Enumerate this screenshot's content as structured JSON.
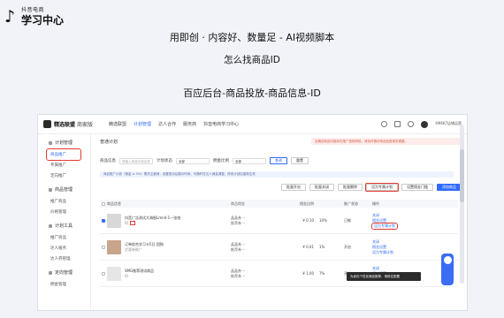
{
  "header": {
    "logo_small": "抖音电商",
    "logo_big": "学习中心",
    "title": "用即创 · 内容好、数量足 - AI视频脚本",
    "subtitle": "怎么找商品ID",
    "path": "百应后台-商品投放-商品信息-ID"
  },
  "app": {
    "brand_name": "精选联盟",
    "brand_sub": "商家版",
    "nav": [
      "精选联盟",
      "计划管理",
      "达人合作",
      "服务商",
      "抖音电商学习中心"
    ],
    "account": "4M4K7店铺运营"
  },
  "sidebar": {
    "groups": [
      {
        "head": "计划管理",
        "items": [
          "商品推广",
          "专属推广",
          "定向推广"
        ]
      },
      {
        "head": "商品管理",
        "items": [
          "推广商品",
          "价格管理"
        ]
      },
      {
        "head": "计划工具",
        "items": [
          "推广商品",
          "达人服务",
          "达人券管理"
        ]
      },
      {
        "head": "定向管理",
        "items": [
          "佣金管理"
        ]
      }
    ]
  },
  "main": {
    "crumb": "普通计划",
    "notice": "近期该商品可能存在推广违规风险，请及时做好商品信息规范调整。",
    "filters": {
      "label1": "商品信息",
      "placeholder1": "请输入商品ID或名称",
      "label2": "计划状态",
      "value2": "全部",
      "label3": "佣金比例",
      "value3": "全部",
      "search": "查询",
      "reset": "重置"
    },
    "tip": "商品推广计划（佣金 ≥ 5%）需关注营销，设置成功后展示时间，可随时在达人佣金调整，修改计划后重新生效",
    "actions": [
      "批量开启",
      "批量关闭",
      "批量删除",
      "设为专属计划",
      "设置佣金门槛",
      "添加商品"
    ],
    "columns": [
      "商品信息",
      "商品佣金",
      "佣金比例",
      "推广状态",
      "操作"
    ],
    "rows": [
      {
        "name": "抖音广告测试大海报Lmn4-1一张拍",
        "id": "ID",
        "metrics": [
          "晶晶券 --",
          "推荐券 --"
        ],
        "price": "¥ 0.10",
        "ratio": "10%",
        "status": "已推",
        "ops": [
          "关闭",
          "佣金设置",
          "设为专属计划"
        ]
      },
      {
        "name": "订单综合学习卡5日 团购",
        "id": "优惠券推广",
        "metrics": [
          "晶晶券 --",
          "推荐券 --"
        ],
        "price": "¥ 0.01",
        "ratio": "1%",
        "status": "开启",
        "ops": [
          "关闭",
          "佣金设置",
          "设为专属计划"
        ]
      },
      {
        "name": "SMG推荐测试商品",
        "id": "ID",
        "metrics": [
          "晶晶券 --",
          "推荐券 --"
        ],
        "price": "¥ 1.00",
        "ratio": "7%",
        "status": "开启",
        "ops": [
          "关闭",
          "佣金设置",
          "设为专属计划"
        ]
      }
    ],
    "float_tip": "为优化个性化商品推荐，请前往配置"
  }
}
